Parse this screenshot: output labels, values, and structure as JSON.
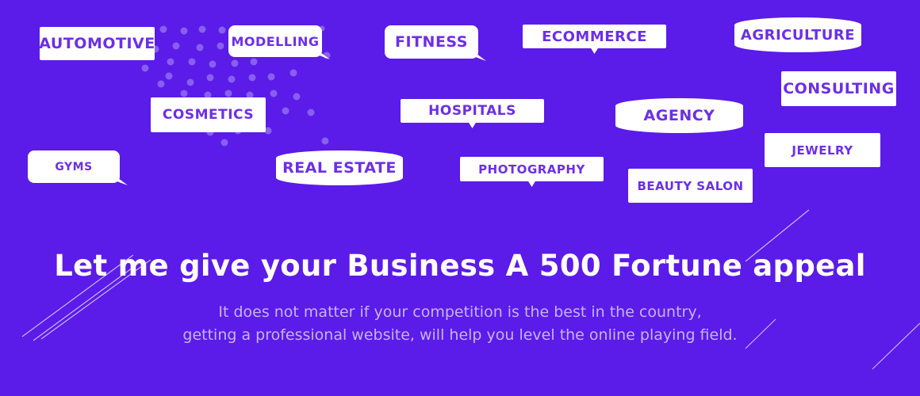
{
  "tags": {
    "automotive": "AUTOMOTIVE",
    "modelling": "MODELLING",
    "fitness": "FITNESS",
    "ecommerce": "ECOMMERCE",
    "agriculture": "AGRICULTURE",
    "consulting": "CONSULTING",
    "cosmetics": "COSMETICS",
    "hospitals": "HOSPITALS",
    "agency": "AGENCY",
    "jewelry": "JEWELRY",
    "gyms": "GYMS",
    "real_estate": "REAL ESTATE",
    "photography": "PHOTOGRAPHY",
    "beauty_salon": "BEAUTY SALON"
  },
  "hero": {
    "headline": "Let me give your Business A 500 Fortune appeal",
    "sub_line_1": "It does not matter if your competition is the best in the country,",
    "sub_line_2": "getting a professional website, will help you level the online playing field."
  },
  "colors": {
    "background": "#5b1be8",
    "tag_text": "#6c2fe6",
    "tag_fill": "#ffffff",
    "subtext": "#c6b4f5"
  }
}
